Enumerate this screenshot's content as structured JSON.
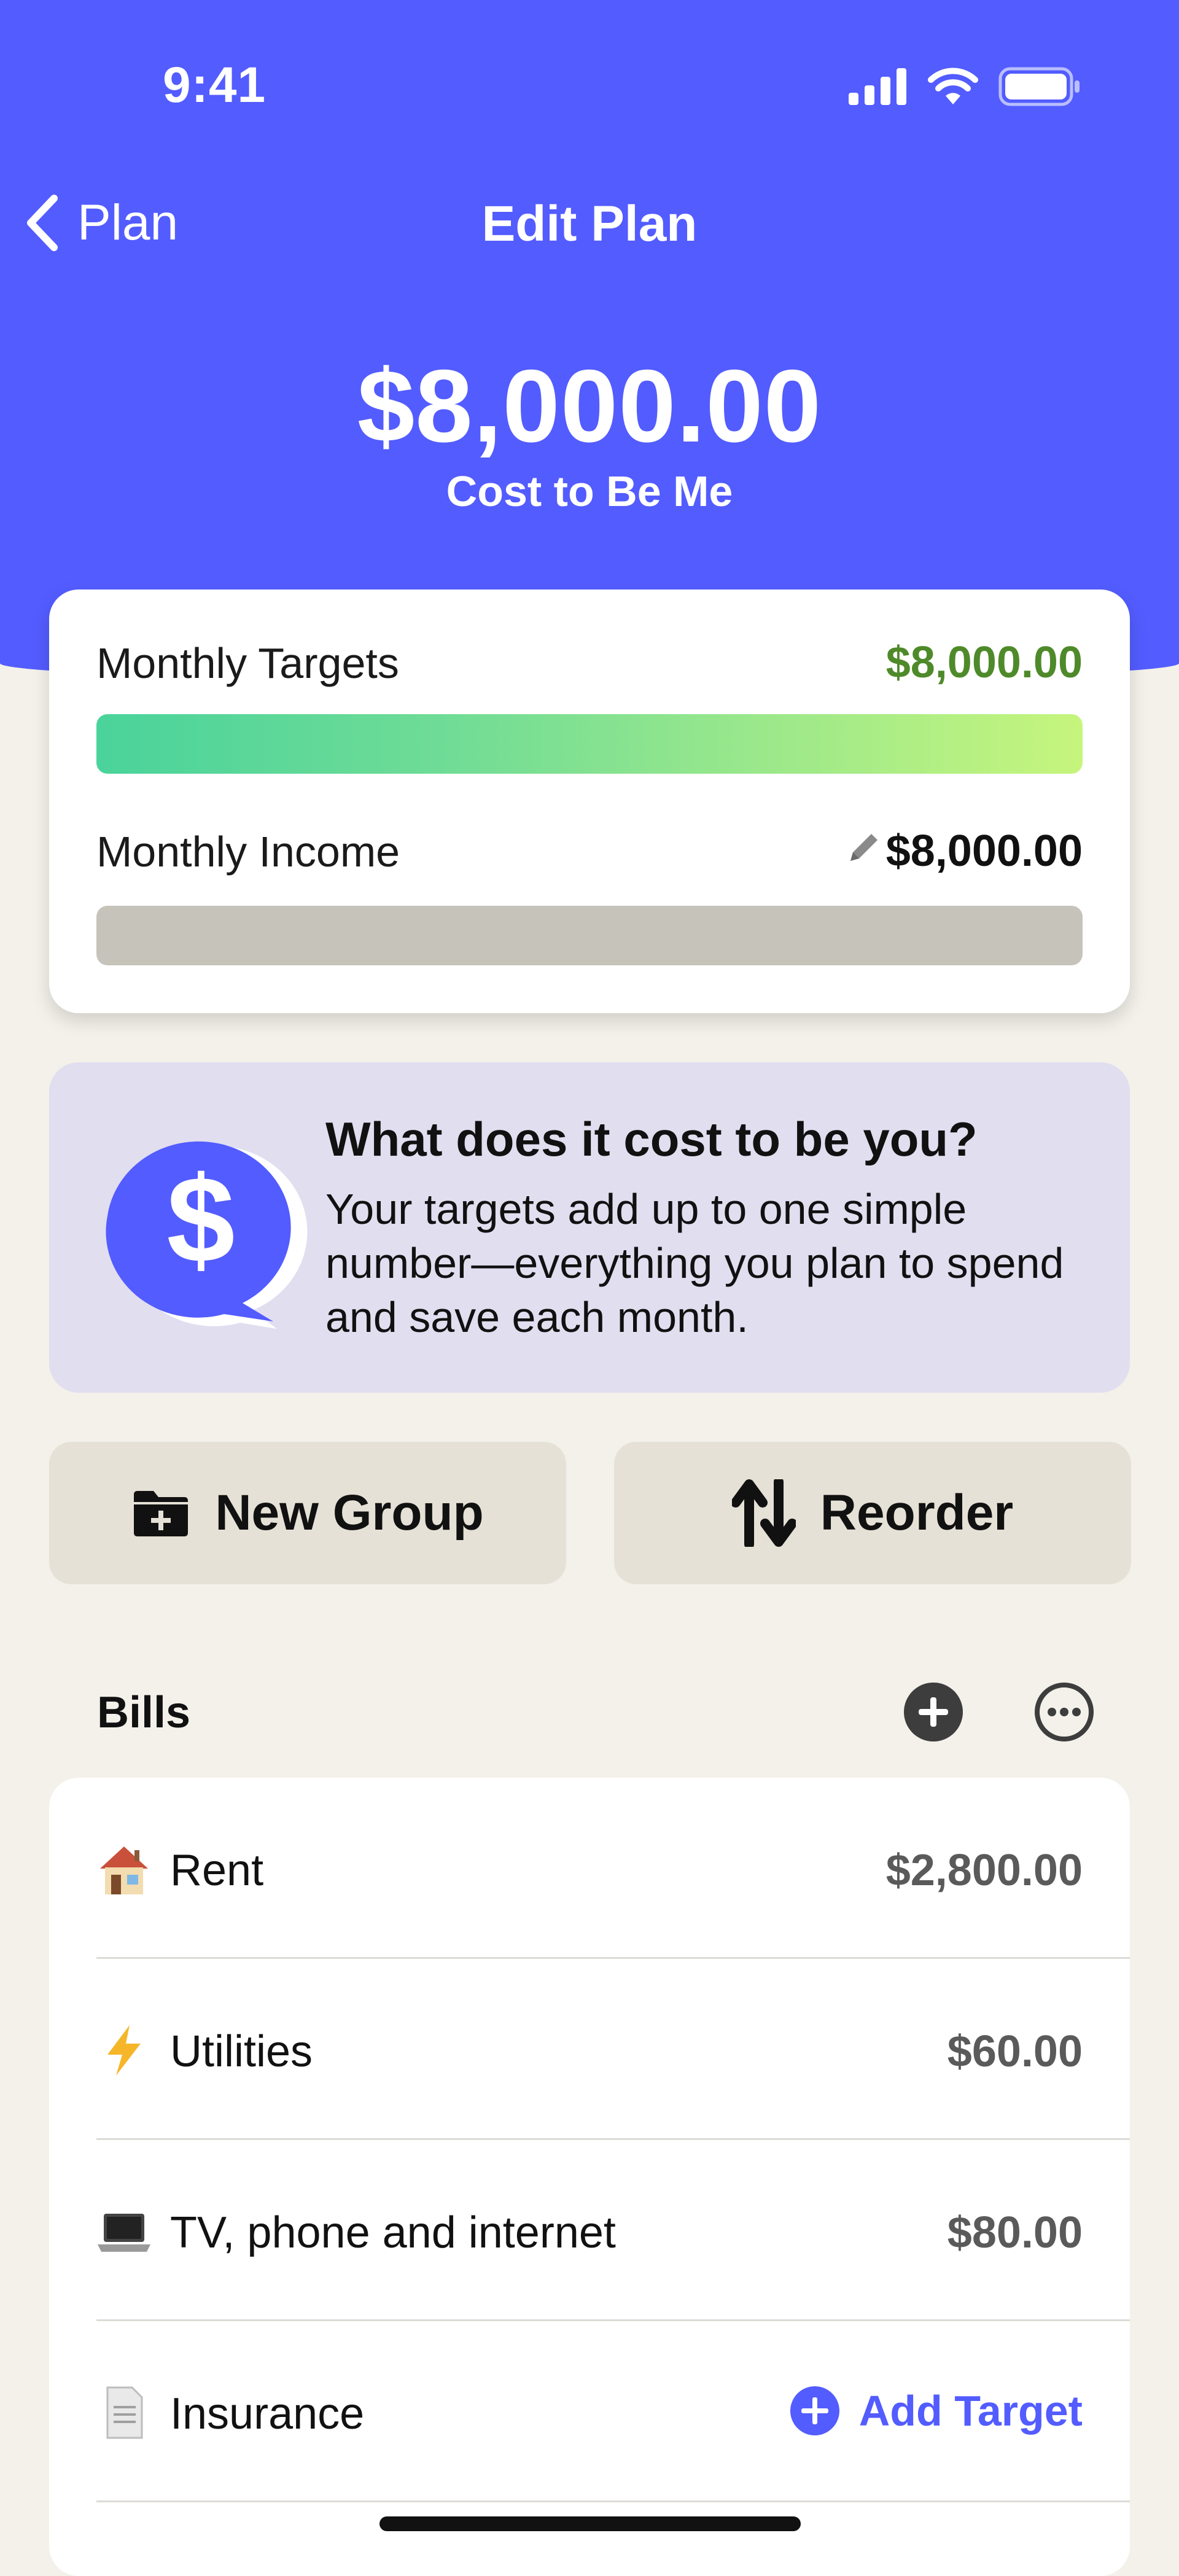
{
  "status_bar": {
    "time": "9:41"
  },
  "nav": {
    "back_label": "Plan",
    "title": "Edit Plan"
  },
  "hero": {
    "amount": "$8,000.00",
    "subtitle": "Cost to Be Me"
  },
  "summary": {
    "targets_label": "Monthly Targets",
    "targets_value": "$8,000.00",
    "targets_fill_fraction": 1.0,
    "income_label": "Monthly Income",
    "income_value": "$8,000.00"
  },
  "info": {
    "title": "What does it cost to be you?",
    "body": "Your targets add up to one simple number—everything you plan to spend and save each month."
  },
  "actions": {
    "new_group_label": "New Group",
    "reorder_label": "Reorder"
  },
  "bills": {
    "title": "Bills",
    "add_target_label": "Add Target",
    "items": [
      {
        "emoji": "house-icon",
        "name": "Rent",
        "amount": "$2,800.00"
      },
      {
        "emoji": "lightning-icon",
        "name": "Utilities",
        "amount": "$60.00"
      },
      {
        "emoji": "laptop-icon",
        "name": "TV, phone and internet",
        "amount": "$80.00"
      },
      {
        "emoji": "document-icon",
        "name": "Insurance",
        "amount": ""
      }
    ]
  },
  "colors": {
    "brand": "#535cff",
    "positive": "#4f8a2a",
    "background": "#f3f1ea"
  }
}
